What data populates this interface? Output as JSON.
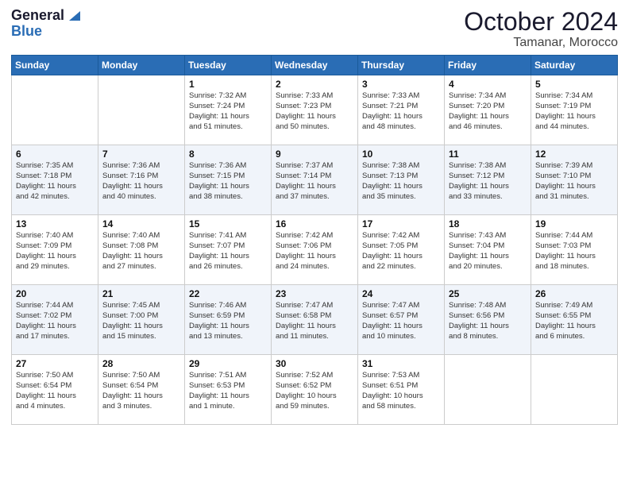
{
  "header": {
    "logo_line1": "General",
    "logo_line2": "Blue",
    "month": "October 2024",
    "location": "Tamanar, Morocco"
  },
  "weekdays": [
    "Sunday",
    "Monday",
    "Tuesday",
    "Wednesday",
    "Thursday",
    "Friday",
    "Saturday"
  ],
  "weeks": [
    [
      {
        "day": "",
        "info": ""
      },
      {
        "day": "",
        "info": ""
      },
      {
        "day": "1",
        "info": "Sunrise: 7:32 AM\nSunset: 7:24 PM\nDaylight: 11 hours\nand 51 minutes."
      },
      {
        "day": "2",
        "info": "Sunrise: 7:33 AM\nSunset: 7:23 PM\nDaylight: 11 hours\nand 50 minutes."
      },
      {
        "day": "3",
        "info": "Sunrise: 7:33 AM\nSunset: 7:21 PM\nDaylight: 11 hours\nand 48 minutes."
      },
      {
        "day": "4",
        "info": "Sunrise: 7:34 AM\nSunset: 7:20 PM\nDaylight: 11 hours\nand 46 minutes."
      },
      {
        "day": "5",
        "info": "Sunrise: 7:34 AM\nSunset: 7:19 PM\nDaylight: 11 hours\nand 44 minutes."
      }
    ],
    [
      {
        "day": "6",
        "info": "Sunrise: 7:35 AM\nSunset: 7:18 PM\nDaylight: 11 hours\nand 42 minutes."
      },
      {
        "day": "7",
        "info": "Sunrise: 7:36 AM\nSunset: 7:16 PM\nDaylight: 11 hours\nand 40 minutes."
      },
      {
        "day": "8",
        "info": "Sunrise: 7:36 AM\nSunset: 7:15 PM\nDaylight: 11 hours\nand 38 minutes."
      },
      {
        "day": "9",
        "info": "Sunrise: 7:37 AM\nSunset: 7:14 PM\nDaylight: 11 hours\nand 37 minutes."
      },
      {
        "day": "10",
        "info": "Sunrise: 7:38 AM\nSunset: 7:13 PM\nDaylight: 11 hours\nand 35 minutes."
      },
      {
        "day": "11",
        "info": "Sunrise: 7:38 AM\nSunset: 7:12 PM\nDaylight: 11 hours\nand 33 minutes."
      },
      {
        "day": "12",
        "info": "Sunrise: 7:39 AM\nSunset: 7:10 PM\nDaylight: 11 hours\nand 31 minutes."
      }
    ],
    [
      {
        "day": "13",
        "info": "Sunrise: 7:40 AM\nSunset: 7:09 PM\nDaylight: 11 hours\nand 29 minutes."
      },
      {
        "day": "14",
        "info": "Sunrise: 7:40 AM\nSunset: 7:08 PM\nDaylight: 11 hours\nand 27 minutes."
      },
      {
        "day": "15",
        "info": "Sunrise: 7:41 AM\nSunset: 7:07 PM\nDaylight: 11 hours\nand 26 minutes."
      },
      {
        "day": "16",
        "info": "Sunrise: 7:42 AM\nSunset: 7:06 PM\nDaylight: 11 hours\nand 24 minutes."
      },
      {
        "day": "17",
        "info": "Sunrise: 7:42 AM\nSunset: 7:05 PM\nDaylight: 11 hours\nand 22 minutes."
      },
      {
        "day": "18",
        "info": "Sunrise: 7:43 AM\nSunset: 7:04 PM\nDaylight: 11 hours\nand 20 minutes."
      },
      {
        "day": "19",
        "info": "Sunrise: 7:44 AM\nSunset: 7:03 PM\nDaylight: 11 hours\nand 18 minutes."
      }
    ],
    [
      {
        "day": "20",
        "info": "Sunrise: 7:44 AM\nSunset: 7:02 PM\nDaylight: 11 hours\nand 17 minutes."
      },
      {
        "day": "21",
        "info": "Sunrise: 7:45 AM\nSunset: 7:00 PM\nDaylight: 11 hours\nand 15 minutes."
      },
      {
        "day": "22",
        "info": "Sunrise: 7:46 AM\nSunset: 6:59 PM\nDaylight: 11 hours\nand 13 minutes."
      },
      {
        "day": "23",
        "info": "Sunrise: 7:47 AM\nSunset: 6:58 PM\nDaylight: 11 hours\nand 11 minutes."
      },
      {
        "day": "24",
        "info": "Sunrise: 7:47 AM\nSunset: 6:57 PM\nDaylight: 11 hours\nand 10 minutes."
      },
      {
        "day": "25",
        "info": "Sunrise: 7:48 AM\nSunset: 6:56 PM\nDaylight: 11 hours\nand 8 minutes."
      },
      {
        "day": "26",
        "info": "Sunrise: 7:49 AM\nSunset: 6:55 PM\nDaylight: 11 hours\nand 6 minutes."
      }
    ],
    [
      {
        "day": "27",
        "info": "Sunrise: 7:50 AM\nSunset: 6:54 PM\nDaylight: 11 hours\nand 4 minutes."
      },
      {
        "day": "28",
        "info": "Sunrise: 7:50 AM\nSunset: 6:54 PM\nDaylight: 11 hours\nand 3 minutes."
      },
      {
        "day": "29",
        "info": "Sunrise: 7:51 AM\nSunset: 6:53 PM\nDaylight: 11 hours\nand 1 minute."
      },
      {
        "day": "30",
        "info": "Sunrise: 7:52 AM\nSunset: 6:52 PM\nDaylight: 10 hours\nand 59 minutes."
      },
      {
        "day": "31",
        "info": "Sunrise: 7:53 AM\nSunset: 6:51 PM\nDaylight: 10 hours\nand 58 minutes."
      },
      {
        "day": "",
        "info": ""
      },
      {
        "day": "",
        "info": ""
      }
    ]
  ]
}
